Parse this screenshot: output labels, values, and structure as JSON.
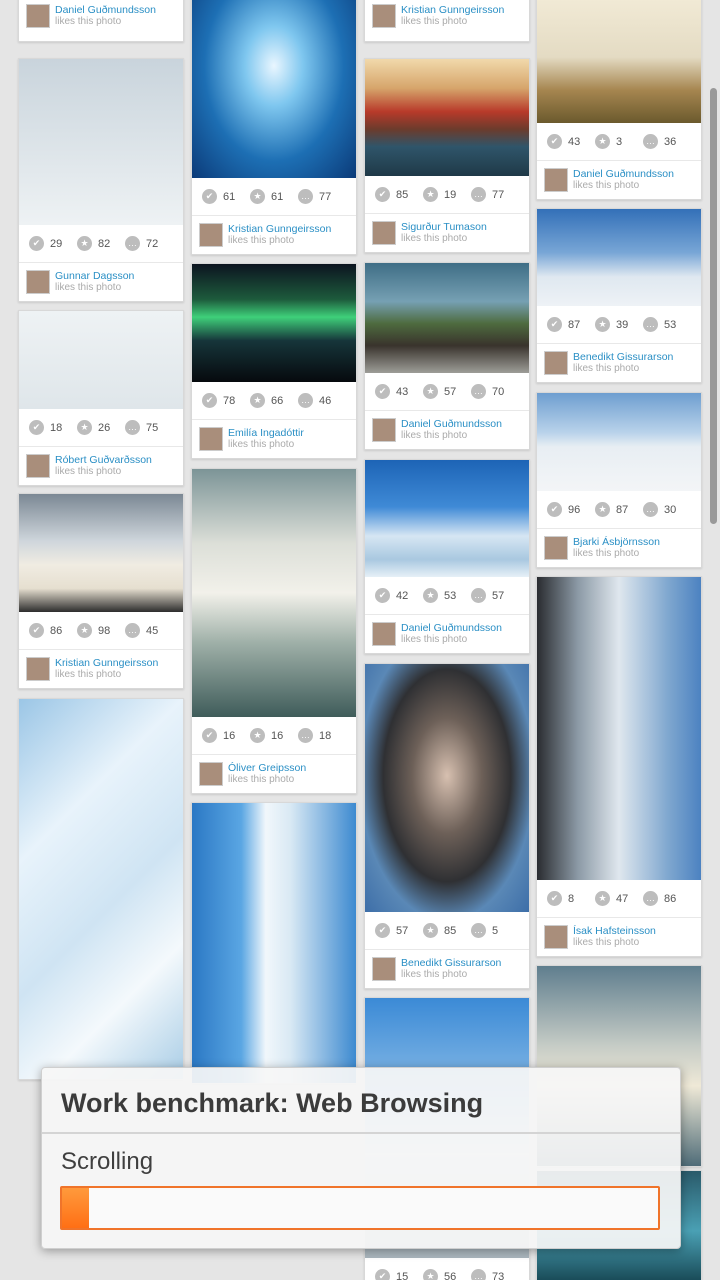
{
  "colors": {
    "accent": "#f0742a",
    "link": "#2a8fc5",
    "meta": "#aaaaaa"
  },
  "icons": {
    "like": "thumbs-up-icon",
    "favorite": "star-icon",
    "comment": "comment-bubble-icon"
  },
  "dialog": {
    "title": "Work benchmark: Web Browsing",
    "subtitle": "Scrolling",
    "progress": 0.045
  },
  "columns": [
    {
      "cards": [
        {
          "name": "Daniel Guðmundsson",
          "label": "likes this photo",
          "stats": null
        },
        {
          "name": "Gunnar Dagsson",
          "label": "likes this photo",
          "stats": [
            "29",
            "82",
            "72"
          ]
        },
        {
          "name": "Róbert Guðvarðsson",
          "label": "likes this photo",
          "stats": [
            "18",
            "26",
            "75"
          ]
        },
        {
          "name": "Kristian Gunngeirsson",
          "label": "likes this photo",
          "stats": [
            "86",
            "98",
            "45"
          ]
        },
        {
          "name": "",
          "label": "",
          "stats": null
        }
      ]
    },
    {
      "cards": [
        {
          "name": "Kristian Gunngeirsson",
          "label": "likes this photo",
          "stats": [
            "61",
            "61",
            "77"
          ]
        },
        {
          "name": "Emilía Ingadóttir",
          "label": "likes this photo",
          "stats": [
            "78",
            "66",
            "46"
          ]
        },
        {
          "name": "Óliver Greipsson",
          "label": "likes this photo",
          "stats": [
            "16",
            "16",
            "18"
          ]
        },
        {
          "name": "",
          "label": "",
          "stats": null
        }
      ]
    },
    {
      "cards": [
        {
          "name": "Kristian Gunngeirsson",
          "label": "likes this photo",
          "stats": null
        },
        {
          "name": "Sigurður Tumason",
          "label": "likes this photo",
          "stats": [
            "85",
            "19",
            "77"
          ]
        },
        {
          "name": "Daniel Guðmundsson",
          "label": "likes this photo",
          "stats": [
            "43",
            "57",
            "70"
          ]
        },
        {
          "name": "Daniel Guðmundsson",
          "label": "likes this photo",
          "stats": [
            "42",
            "53",
            "57"
          ]
        },
        {
          "name": "Benedikt Gissurarson",
          "label": "likes this photo",
          "stats": [
            "57",
            "85",
            "5"
          ]
        },
        {
          "name": "",
          "label": "",
          "stats": [
            "15",
            "56",
            "73"
          ]
        }
      ]
    },
    {
      "cards": [
        {
          "name": "Daniel Guðmundsson",
          "label": "likes this photo",
          "stats": [
            "43",
            "3",
            "36"
          ]
        },
        {
          "name": "Benedikt Gissurarson",
          "label": "likes this photo",
          "stats": [
            "87",
            "39",
            "53"
          ]
        },
        {
          "name": "Bjarki Ásbjörnsson",
          "label": "likes this photo",
          "stats": [
            "96",
            "87",
            "30"
          ]
        },
        {
          "name": "Ísak Hafsteinsson",
          "label": "likes this photo",
          "stats": [
            "8",
            "47",
            "86"
          ]
        },
        {
          "name": "",
          "label": "",
          "stats": null
        },
        {
          "name": "",
          "label": "",
          "stats": null
        }
      ]
    }
  ]
}
